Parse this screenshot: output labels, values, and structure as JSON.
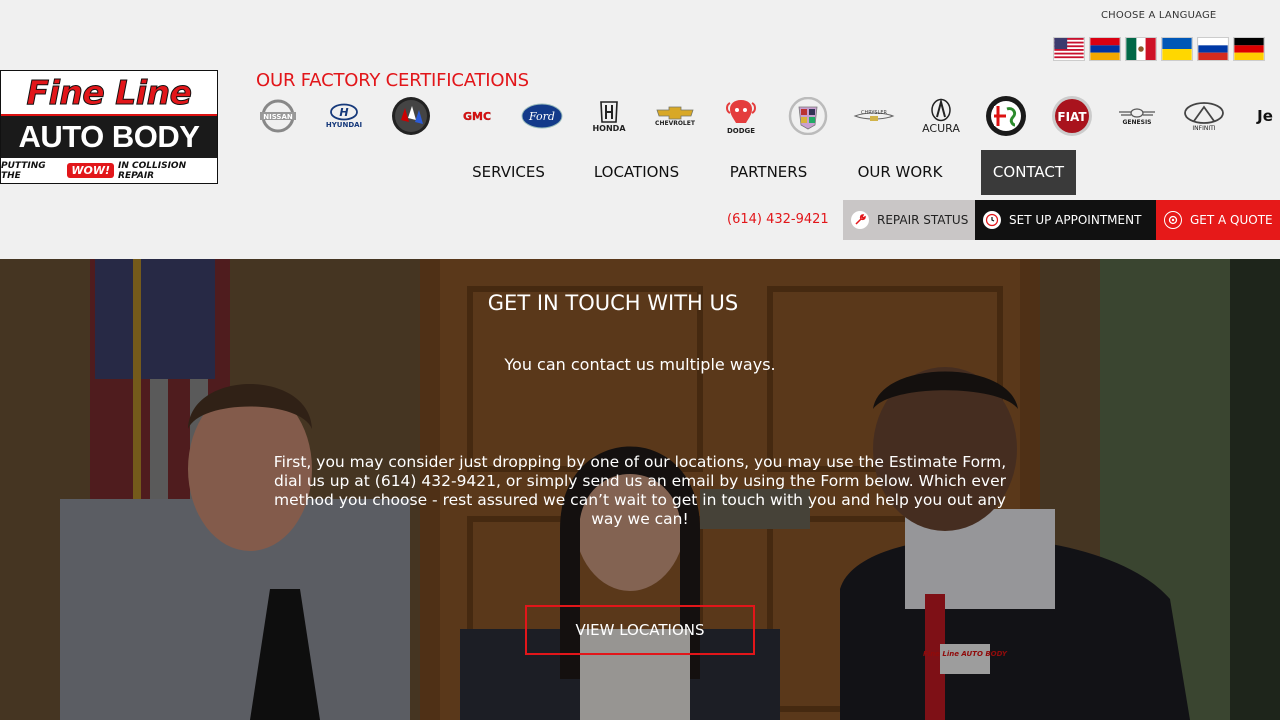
{
  "header": {
    "language_label": "CHOOSE A LANGUAGE",
    "flags": [
      "us-flag-icon",
      "armenia-flag-icon",
      "mexico-flag-icon",
      "ukraine-flag-icon",
      "russia-flag-icon",
      "germany-flag-icon"
    ],
    "logo": {
      "line1": "Fine Line",
      "line2": "AUTO BODY",
      "tagline_pre": "PUTTING THE",
      "tagline_wow": "WOW!",
      "tagline_post": "IN COLLISION REPAIR"
    },
    "certifications_title": "OUR FACTORY CERTIFICATIONS",
    "brands": [
      {
        "name": "NISSAN",
        "icon": "nissan-logo"
      },
      {
        "name": "HYUNDAI",
        "icon": "hyundai-logo"
      },
      {
        "name": "",
        "icon": "buick-logo"
      },
      {
        "name": "GMC",
        "icon": "gmc-logo"
      },
      {
        "name": "Ford",
        "icon": "ford-logo"
      },
      {
        "name": "HONDA",
        "icon": "honda-logo"
      },
      {
        "name": "CHEVROLET",
        "icon": "chevrolet-logo"
      },
      {
        "name": "DODGE",
        "icon": "dodge-logo"
      },
      {
        "name": "",
        "icon": "cadillac-logo"
      },
      {
        "name": "CHRYSLER",
        "icon": "chrysler-logo"
      },
      {
        "name": "ACURA",
        "icon": "acura-logo"
      },
      {
        "name": "",
        "icon": "alfa-romeo-logo"
      },
      {
        "name": "FIAT",
        "icon": "fiat-logo"
      },
      {
        "name": "GENESIS",
        "icon": "genesis-logo"
      },
      {
        "name": "INFINITI",
        "icon": "infiniti-logo"
      },
      {
        "name": "Je",
        "icon": "jeep-logo"
      }
    ],
    "nav": [
      "SERVICES",
      "LOCATIONS",
      "PARTNERS",
      "OUR WORK",
      "CONTACT"
    ],
    "active_nav": "CONTACT",
    "phone": "(614) 432-9421",
    "cta": {
      "repair_status": "REPAIR STATUS",
      "appointment": "SET UP APPOINTMENT",
      "quote": "GET A QUOTE"
    }
  },
  "hero": {
    "title": "GET IN TOUCH WITH US",
    "subtitle": "You can contact us multiple ways.",
    "body": "First, you may consider just dropping by one of our locations, you may use the Estimate Form, dial us up at (614) 432-9421, or simply send us an email by using the Form below. Which ever method you choose - rest assured we can’t wait to get in touch with you and help you out any way we can!",
    "button": "VIEW LOCATIONS",
    "uniform_logo": "Fine Line AUTO BODY"
  },
  "colors": {
    "brand_red": "#e2161a",
    "dark": "#111111",
    "header_bg": "#f0f0f0"
  }
}
